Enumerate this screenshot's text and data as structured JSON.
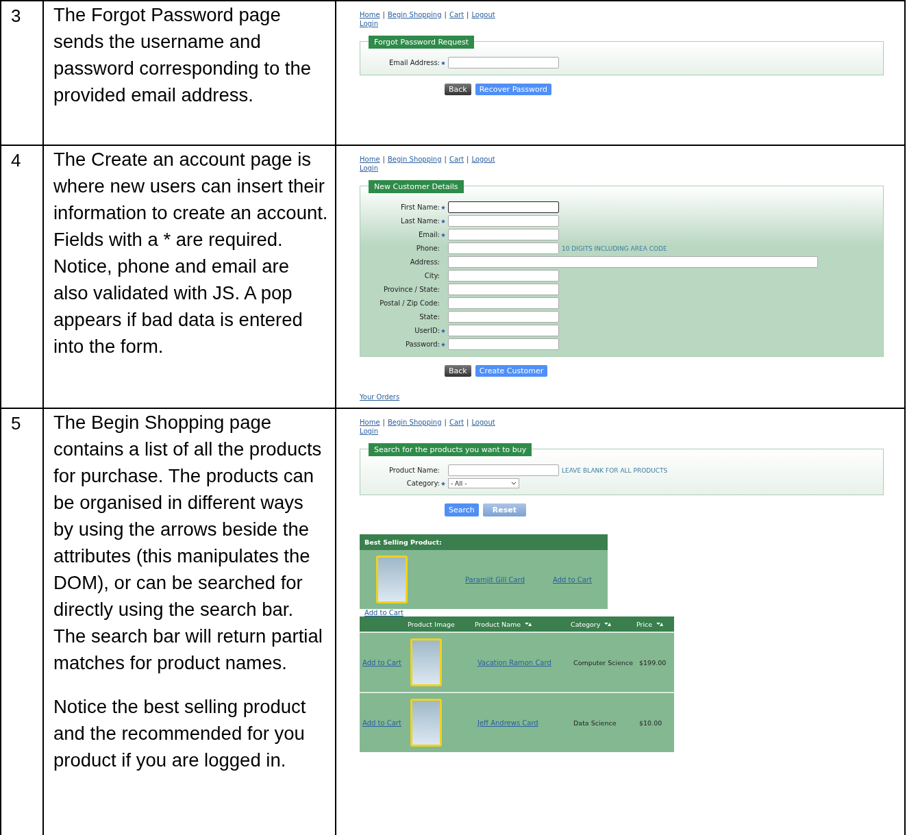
{
  "rows": [
    {
      "number": "3",
      "paragraphs": [
        "The Forgot Password page sends the username and password corresponding to the provided email address."
      ],
      "screenshot": {
        "separator": "|",
        "nav_links": [
          "Home",
          "Begin Shopping",
          "Cart",
          "Logout"
        ],
        "login_link": "Login",
        "form": {
          "legend": "Forgot Password Request",
          "shaded": false,
          "fields": [
            {
              "label": "Email Address:",
              "required": true,
              "focused": false,
              "wide": false,
              "kind": "text"
            }
          ]
        },
        "buttons": [
          {
            "label": "Back",
            "kind": "dark"
          },
          {
            "label": "Recover Password",
            "kind": "blue"
          }
        ]
      }
    },
    {
      "number": "4",
      "paragraphs": [
        "The Create an account page is where new users can insert their information to create an account. Fields with a * are required. Notice, phone and email are also validated with JS. A pop appears if bad data is entered into the form."
      ],
      "screenshot": {
        "separator": "|",
        "nav_links": [
          "Home",
          "Begin Shopping",
          "Cart",
          "Logout"
        ],
        "login_link": "Login",
        "form": {
          "legend": "New Customer Details",
          "shaded": true,
          "fields": [
            {
              "label": "First Name:",
              "required": true,
              "focused": true,
              "wide": false,
              "kind": "text"
            },
            {
              "label": "Last Name:",
              "required": true,
              "focused": false,
              "wide": false,
              "kind": "text"
            },
            {
              "label": "Email:",
              "required": true,
              "focused": false,
              "wide": false,
              "kind": "text"
            },
            {
              "label": "Phone:",
              "required": false,
              "focused": false,
              "wide": false,
              "kind": "text",
              "hint": "10 DIGITS INCLUDING AREA CODE"
            },
            {
              "label": "Address:",
              "required": false,
              "focused": false,
              "wide": true,
              "kind": "text"
            },
            {
              "label": "City:",
              "required": false,
              "focused": false,
              "wide": false,
              "kind": "text"
            },
            {
              "label": "Province / State:",
              "required": false,
              "focused": false,
              "wide": false,
              "kind": "text"
            },
            {
              "label": "Postal / Zip Code:",
              "required": false,
              "focused": false,
              "wide": false,
              "kind": "text"
            },
            {
              "label": "State:",
              "required": false,
              "focused": false,
              "wide": false,
              "kind": "text"
            },
            {
              "label": "UserID:",
              "required": true,
              "focused": false,
              "wide": false,
              "kind": "text"
            },
            {
              "label": "Password:",
              "required": true,
              "focused": false,
              "wide": false,
              "kind": "text"
            }
          ]
        },
        "buttons": [
          {
            "label": "Back",
            "kind": "dark"
          },
          {
            "label": "Create Customer",
            "kind": "blue"
          }
        ],
        "footer_link": "Your Orders"
      }
    },
    {
      "number": "5",
      "paragraphs": [
        "The Begin Shopping page contains a list of all the products for purchase. The products can be organised in different ways by using the arrows beside the attributes (this manipulates the DOM), or can be searched for directly using the search bar. The search bar will return partial matches for product names.",
        "Notice the best selling product and the recommended for you product if you are logged in."
      ],
      "screenshot": {
        "separator": "|",
        "nav_links": [
          "Home",
          "Begin Shopping",
          "Cart",
          "Logout"
        ],
        "login_link": "Login",
        "form": {
          "legend": "Search for the products you want to buy",
          "shaded": false,
          "fields": [
            {
              "label": "Product Name:",
              "required": false,
              "focused": false,
              "wide": false,
              "kind": "text",
              "hint": "LEAVE BLANK FOR ALL PRODUCTS"
            },
            {
              "label": "Category:",
              "required": true,
              "kind": "select",
              "value": "- All -"
            }
          ]
        },
        "buttons": [
          {
            "label": "Search",
            "kind": "blue"
          },
          {
            "label": "Reset",
            "kind": "light"
          }
        ],
        "best_selling": {
          "title": "Best Selling Product:",
          "name": "Paramjit Gill Card",
          "action": "Add to Cart"
        },
        "table_link": "Add to Cart",
        "product_table": {
          "columns": [
            {
              "sortable": false
            },
            {
              "label": "Product Image",
              "sortable": false
            },
            {
              "label": "Product Name",
              "sortable": true
            },
            {
              "label": "Category",
              "sortable": true
            },
            {
              "label": "Price",
              "sortable": true
            }
          ],
          "rows": [
            {
              "action": "Add to Cart",
              "name": "Vacation Ramon Card",
              "category": "Computer Science",
              "price": "$199.00"
            },
            {
              "action": "Add to Cart",
              "name": "Jeff Andrews Card",
              "category": "Data Science",
              "price": "$10.00"
            }
          ]
        }
      }
    }
  ]
}
